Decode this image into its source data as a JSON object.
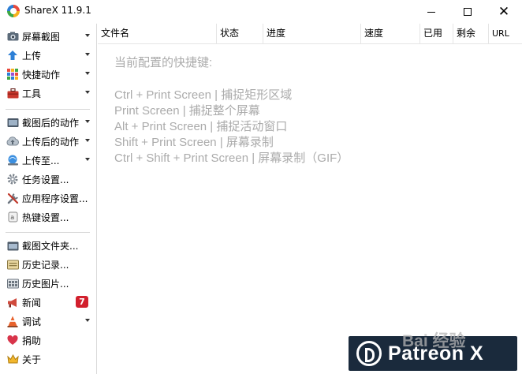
{
  "window": {
    "title": "ShareX 11.9.1"
  },
  "sidebar": {
    "items": [
      {
        "label": "屏幕截图",
        "icon": "camera-icon",
        "dropdown": true
      },
      {
        "label": "上传",
        "icon": "upload-arrow-icon",
        "dropdown": true
      },
      {
        "label": "快捷动作",
        "icon": "grid-icon",
        "dropdown": true
      },
      {
        "label": "工具",
        "icon": "toolbox-icon",
        "dropdown": true
      },
      {
        "label": "截图后的动作",
        "icon": "capture-tasks-icon",
        "dropdown": true
      },
      {
        "label": "上传后的动作",
        "icon": "cloud-upload-icon",
        "dropdown": true
      },
      {
        "label": "上传至...",
        "icon": "destination-icon",
        "dropdown": true
      },
      {
        "label": "任务设置...",
        "icon": "gear-icon",
        "dropdown": false
      },
      {
        "label": "应用程序设置...",
        "icon": "wrench-icon",
        "dropdown": false
      },
      {
        "label": "热键设置...",
        "icon": "keyboard-icon",
        "dropdown": false
      },
      {
        "label": "截图文件夹...",
        "icon": "folder-icon",
        "dropdown": false
      },
      {
        "label": "历史记录...",
        "icon": "history-icon",
        "dropdown": false
      },
      {
        "label": "历史图片...",
        "icon": "image-history-icon",
        "dropdown": false
      },
      {
        "label": "新闻",
        "icon": "megaphone-icon",
        "dropdown": false,
        "badge": "7"
      },
      {
        "label": "调试",
        "icon": "warning-cone-icon",
        "dropdown": true
      },
      {
        "label": "捐助",
        "icon": "heart-icon",
        "dropdown": false
      },
      {
        "label": "关于",
        "icon": "crown-icon",
        "dropdown": false
      }
    ]
  },
  "columns": [
    "文件名",
    "状态",
    "进度",
    "速度",
    "已用",
    "剩余",
    "URL"
  ],
  "hints": {
    "title": "当前配置的快捷键:",
    "lines": [
      "Ctrl + Print Screen  |  捕捉矩形区域",
      "Print Screen  |  捕捉整个屏幕",
      "Alt + Print Screen  |  捕捉活动窗口",
      "Shift + Print Screen  |  屏幕录制",
      "Ctrl + Shift + Print Screen  |  屏幕录制（GIF）"
    ]
  },
  "watermark": {
    "text": "Patreon X",
    "baidu": "Bai 经验"
  },
  "colors": {
    "badge": "#d2202d",
    "hint_text": "#ababab",
    "watermark_bg": "#1a2a3c"
  }
}
